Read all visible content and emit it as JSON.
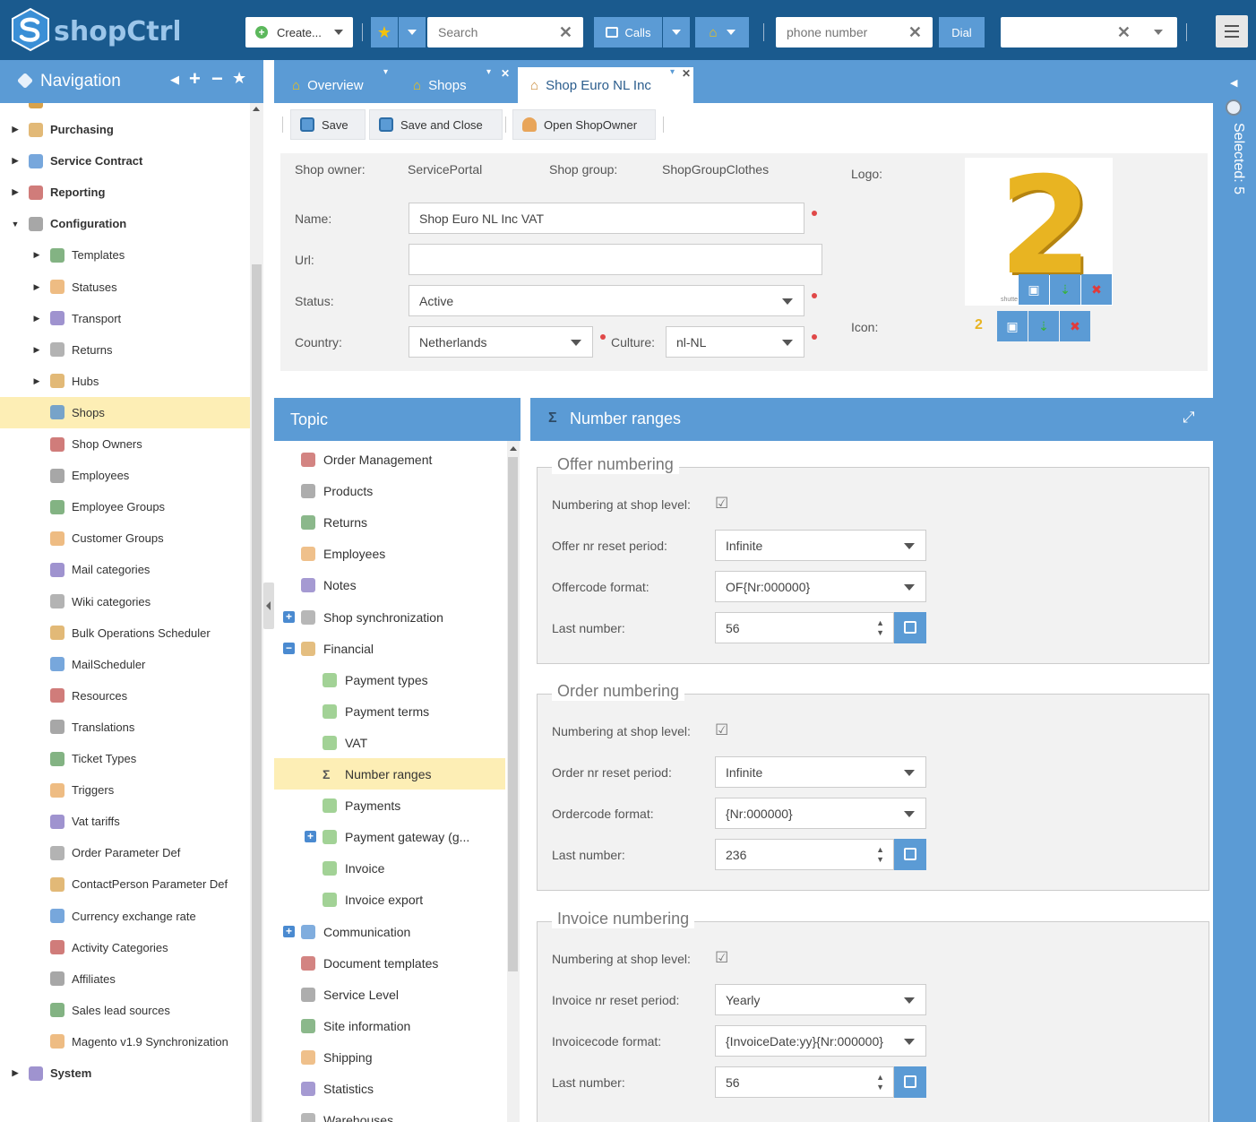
{
  "app": {
    "logo_text": "shopCtrl"
  },
  "topbar": {
    "create_label": "Create...",
    "search_placeholder": "Search",
    "calls_label": "Calls",
    "phone_placeholder": "phone number",
    "dial_label": "Dial"
  },
  "nav": {
    "title": "Navigation",
    "items": [
      {
        "label": "Purchasing",
        "level": 0,
        "expand": "collapsed"
      },
      {
        "label": "Service Contract",
        "level": 0,
        "expand": "collapsed"
      },
      {
        "label": "Reporting",
        "level": 0,
        "expand": "collapsed"
      },
      {
        "label": "Configuration",
        "level": 0,
        "expand": "expanded"
      },
      {
        "label": "Templates",
        "level": 1,
        "expand": "collapsed"
      },
      {
        "label": "Statuses",
        "level": 1,
        "expand": "collapsed"
      },
      {
        "label": "Transport",
        "level": 1,
        "expand": "collapsed"
      },
      {
        "label": "Returns",
        "level": 1,
        "expand": "collapsed"
      },
      {
        "label": "Hubs",
        "level": 1,
        "expand": "collapsed"
      },
      {
        "label": "Shops",
        "level": 1,
        "expand": "none",
        "selected": true
      },
      {
        "label": "Shop Owners",
        "level": 1,
        "expand": "none"
      },
      {
        "label": "Employees",
        "level": 1,
        "expand": "none"
      },
      {
        "label": "Employee Groups",
        "level": 1,
        "expand": "none"
      },
      {
        "label": "Customer Groups",
        "level": 1,
        "expand": "none"
      },
      {
        "label": "Mail categories",
        "level": 1,
        "expand": "none"
      },
      {
        "label": "Wiki categories",
        "level": 1,
        "expand": "none"
      },
      {
        "label": "Bulk Operations Scheduler",
        "level": 1,
        "expand": "none"
      },
      {
        "label": "MailScheduler",
        "level": 1,
        "expand": "none"
      },
      {
        "label": "Resources",
        "level": 1,
        "expand": "none"
      },
      {
        "label": "Translations",
        "level": 1,
        "expand": "none"
      },
      {
        "label": "Ticket Types",
        "level": 1,
        "expand": "none"
      },
      {
        "label": "Triggers",
        "level": 1,
        "expand": "none"
      },
      {
        "label": "Vat tariffs",
        "level": 1,
        "expand": "none"
      },
      {
        "label": "Order Parameter Def",
        "level": 1,
        "expand": "none"
      },
      {
        "label": "ContactPerson Parameter Def",
        "level": 1,
        "expand": "none"
      },
      {
        "label": "Currency exchange rate",
        "level": 1,
        "expand": "none"
      },
      {
        "label": "Activity Categories",
        "level": 1,
        "expand": "none"
      },
      {
        "label": "Affiliates",
        "level": 1,
        "expand": "none"
      },
      {
        "label": "Sales lead sources",
        "level": 1,
        "expand": "none"
      },
      {
        "label": "Magento v1.9 Synchronization",
        "level": 1,
        "expand": "none"
      },
      {
        "label": "System",
        "level": 0,
        "expand": "collapsed"
      }
    ]
  },
  "tabs": [
    {
      "label": "Overview",
      "active": false
    },
    {
      "label": "Shops",
      "active": false
    },
    {
      "label": "Shop Euro NL Inc",
      "active": true
    }
  ],
  "right_strip": {
    "selected_label": "Selected: 5"
  },
  "toolbar": {
    "save": "Save",
    "save_close": "Save and Close",
    "open_owner": "Open ShopOwner"
  },
  "form": {
    "shop_owner_label": "Shop owner:",
    "shop_owner_value": "ServicePortal",
    "shop_group_label": "Shop group:",
    "shop_group_value": "ShopGroupClothes",
    "logo_label": "Logo:",
    "icon_label": "Icon:",
    "name_label": "Name:",
    "name_value": "Shop Euro NL Inc VAT",
    "url_label": "Url:",
    "url_value": "",
    "status_label": "Status:",
    "status_value": "Active",
    "country_label": "Country:",
    "country_value": "Netherlands",
    "culture_label": "Culture:",
    "culture_value": "nl-NL",
    "logo_glyph": "2",
    "logo_watermark": "shutte"
  },
  "topic": {
    "title": "Topic",
    "items": [
      {
        "label": "Order Management",
        "indent": 0,
        "toggle": ""
      },
      {
        "label": "Products",
        "indent": 0,
        "toggle": ""
      },
      {
        "label": "Returns",
        "indent": 0,
        "toggle": ""
      },
      {
        "label": "Employees",
        "indent": 0,
        "toggle": ""
      },
      {
        "label": "Notes",
        "indent": 0,
        "toggle": ""
      },
      {
        "label": "Shop synchronization",
        "indent": 0,
        "toggle": "+"
      },
      {
        "label": "Financial",
        "indent": 0,
        "toggle": "−"
      },
      {
        "label": "Payment types",
        "indent": 1,
        "toggle": ""
      },
      {
        "label": "Payment terms",
        "indent": 1,
        "toggle": ""
      },
      {
        "label": "VAT",
        "indent": 1,
        "toggle": ""
      },
      {
        "label": "Number ranges",
        "indent": 1,
        "toggle": "",
        "selected": true
      },
      {
        "label": "Payments",
        "indent": 1,
        "toggle": ""
      },
      {
        "label": "Payment gateway (g...",
        "indent": 1,
        "toggle": "+"
      },
      {
        "label": "Invoice",
        "indent": 1,
        "toggle": ""
      },
      {
        "label": "Invoice export",
        "indent": 1,
        "toggle": ""
      },
      {
        "label": "Communication",
        "indent": 0,
        "toggle": "+"
      },
      {
        "label": "Document templates",
        "indent": 0,
        "toggle": ""
      },
      {
        "label": "Service Level",
        "indent": 0,
        "toggle": ""
      },
      {
        "label": "Site information",
        "indent": 0,
        "toggle": ""
      },
      {
        "label": "Shipping",
        "indent": 0,
        "toggle": ""
      },
      {
        "label": "Statistics",
        "indent": 0,
        "toggle": ""
      },
      {
        "label": "Warehouses",
        "indent": 0,
        "toggle": ""
      }
    ]
  },
  "number_ranges": {
    "title": "Number ranges",
    "sections": [
      {
        "legend": "Offer numbering",
        "shop_level_label": "Numbering at shop level:",
        "shop_level_checked": true,
        "reset_label": "Offer nr reset period:",
        "reset_value": "Infinite",
        "format_label": "Offercode format:",
        "format_value": "OF{Nr:000000}",
        "last_label": "Last number:",
        "last_value": "56"
      },
      {
        "legend": "Order numbering",
        "shop_level_label": "Numbering at shop level:",
        "shop_level_checked": true,
        "reset_label": "Order nr reset period:",
        "reset_value": "Infinite",
        "format_label": "Ordercode format:",
        "format_value": "{Nr:000000}",
        "last_label": "Last number:",
        "last_value": "236"
      },
      {
        "legend": "Invoice numbering",
        "shop_level_label": "Numbering at shop level:",
        "shop_level_checked": true,
        "reset_label": "Invoice nr reset period:",
        "reset_value": "Yearly",
        "format_label": "Invoicecode format:",
        "format_value": "{InvoiceDate:yy}{Nr:000000}",
        "last_label": "Last number:",
        "last_value": "56"
      }
    ]
  },
  "colors": {
    "brand": "#1a5a8e",
    "accent": "#5b9bd5",
    "selected": "#fdeeb5",
    "required": "#e04848"
  }
}
